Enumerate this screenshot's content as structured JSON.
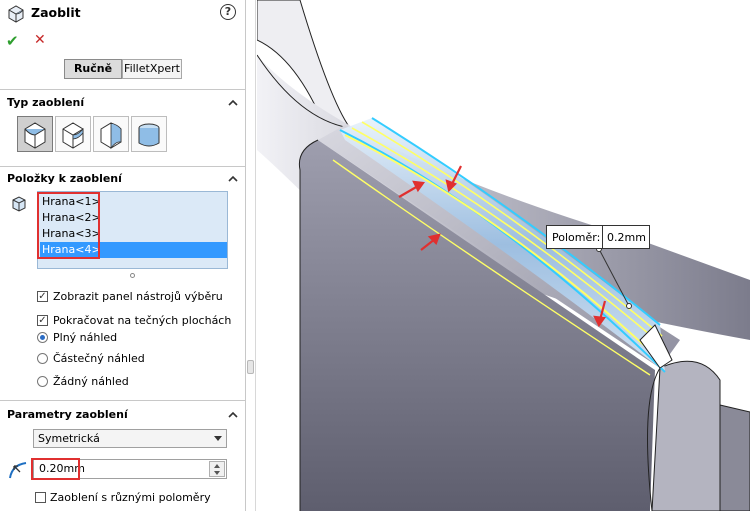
{
  "header": {
    "title": "Zaoblit",
    "help": "?"
  },
  "actions": {
    "ok": "✔",
    "cancel": "✕"
  },
  "mode_tabs": [
    {
      "label": "Ručně"
    },
    {
      "label": "FilletXpert"
    }
  ],
  "sections": {
    "type": {
      "title": "Typ zaoblení"
    },
    "items": {
      "title": "Položky k zaoblení"
    },
    "params": {
      "title": "Parametry zaoblení"
    }
  },
  "fillet_types": [
    "constant-size-fillet-icon",
    "variable-size-fillet-icon",
    "face-fillet-icon",
    "full-round-fillet-icon"
  ],
  "edges": [
    {
      "label": "Hrana<1>"
    },
    {
      "label": "Hrana<2>"
    },
    {
      "label": "Hrana<3>"
    },
    {
      "label": "Hrana<4>"
    }
  ],
  "options": {
    "show_toolbar": {
      "label": "Zobrazit panel nástrojů výběru",
      "checked": true
    },
    "tangent": {
      "label": "Pokračovat na tečných plochách",
      "checked": true
    },
    "preview_full": {
      "label": "Plný náhled",
      "selected": true
    },
    "preview_partial": {
      "label": "Částečný náhled",
      "selected": false
    },
    "preview_none": {
      "label": "Žádný náhled",
      "selected": false
    }
  },
  "params": {
    "profile": "Symetrická",
    "radius": "0.20mm",
    "multi_radius": {
      "label": "Zaoblení s různými poloměry",
      "checked": false
    }
  },
  "viewport": {
    "callout_label": "Poloměr:",
    "callout_value": "0.2mm"
  },
  "colors": {
    "selection": "#3399ff",
    "highlight": "#e03030",
    "edge_preview": "#ffff66",
    "edge_cyan": "#33ccff"
  }
}
